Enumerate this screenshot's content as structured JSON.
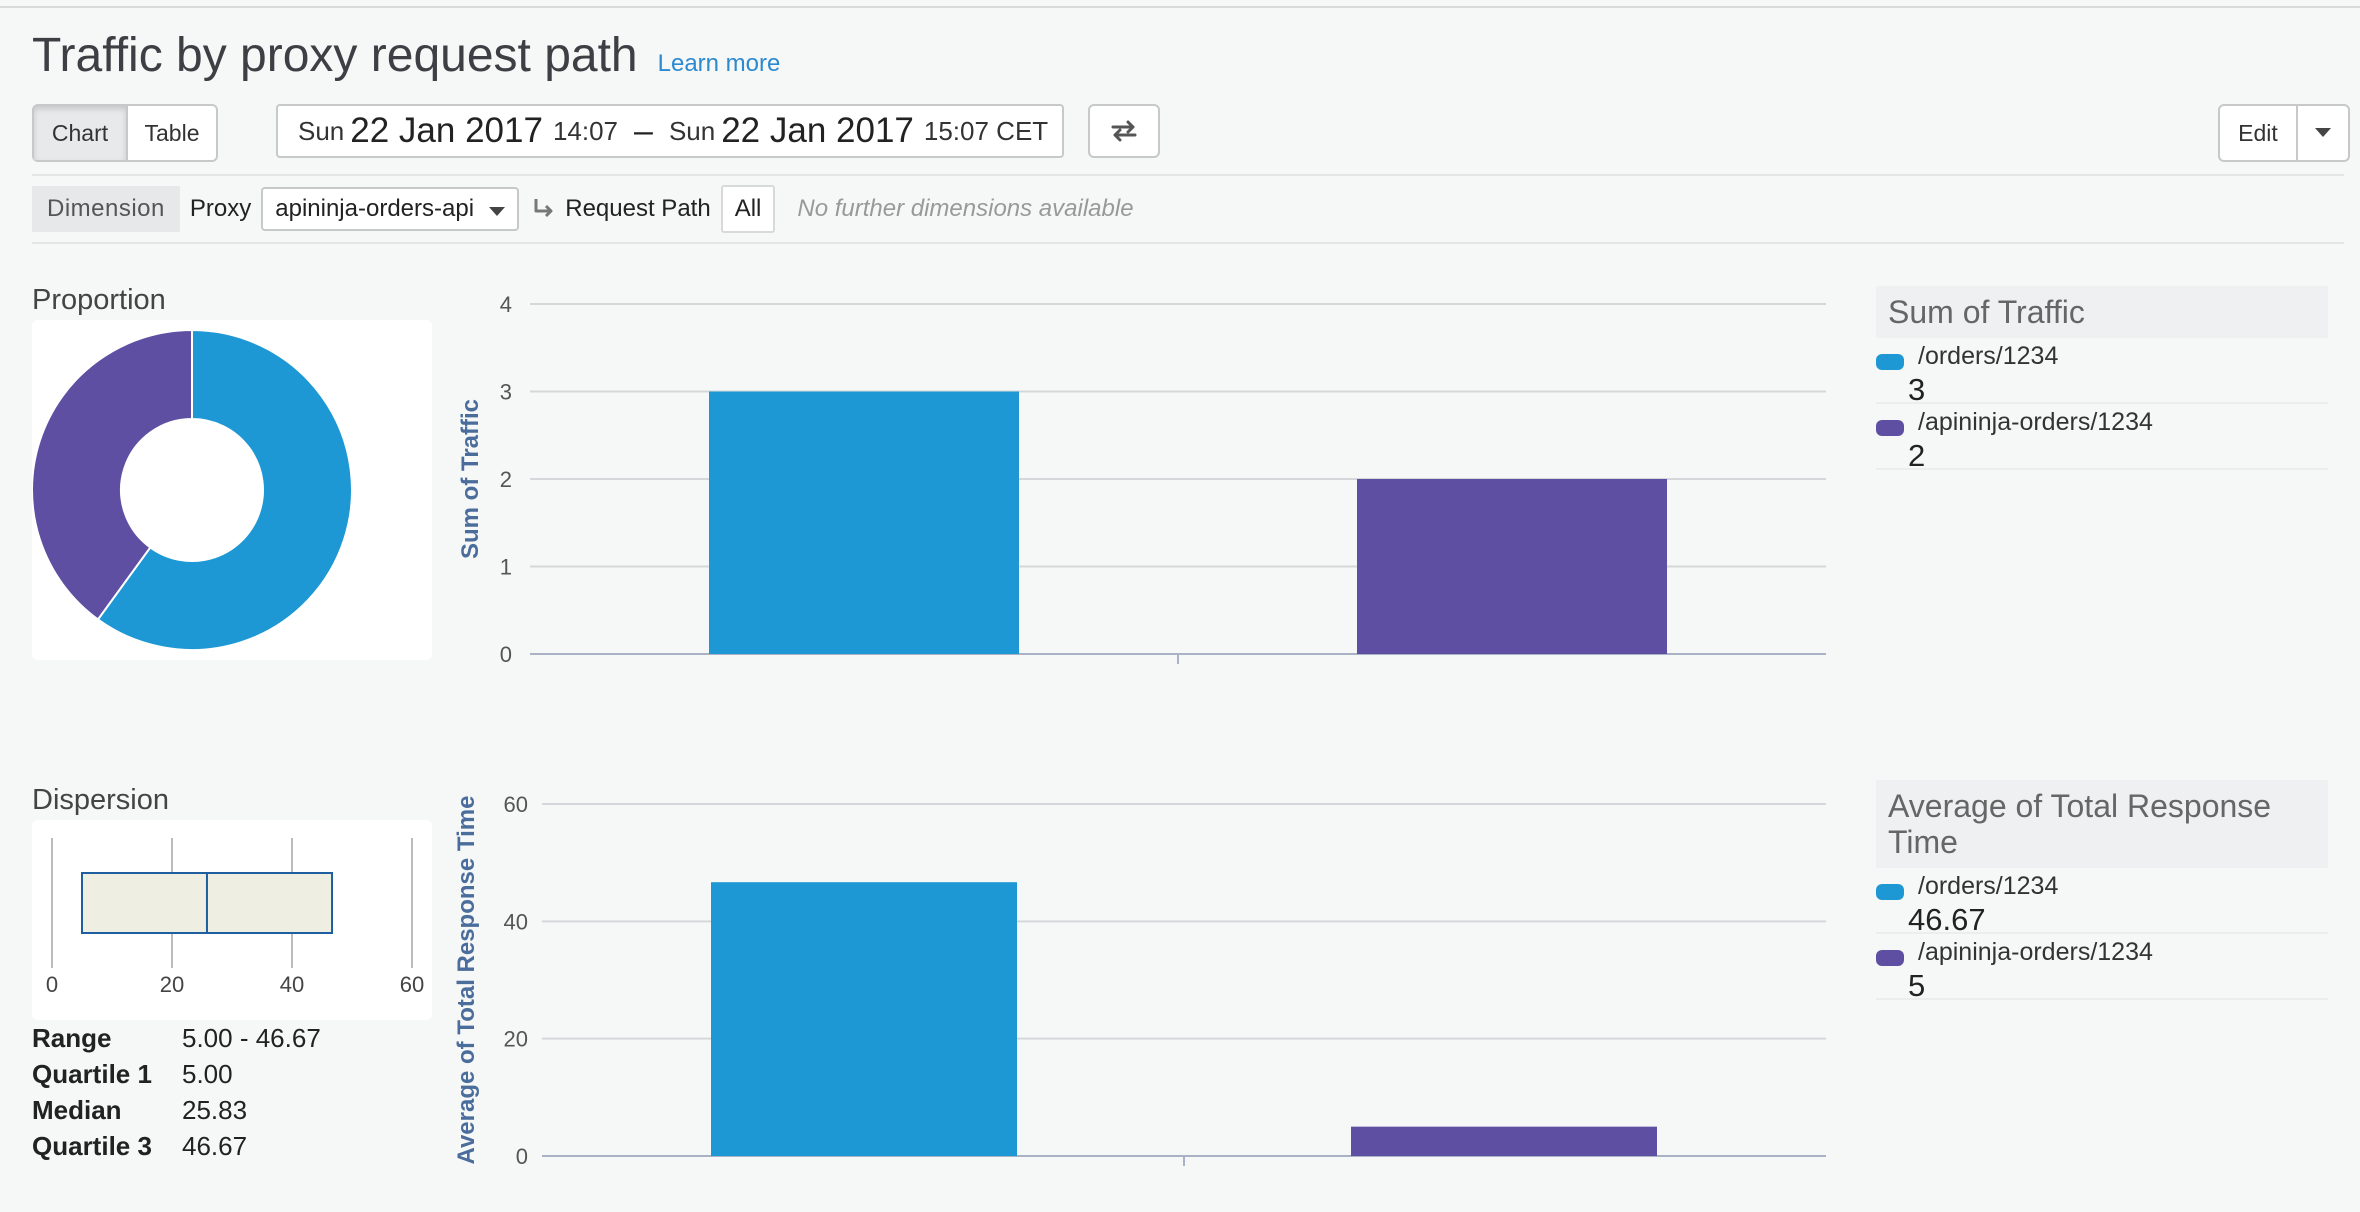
{
  "header": {
    "title": "Traffic by proxy request path",
    "learn_more": "Learn more"
  },
  "view_toggle": {
    "chart": "Chart",
    "table": "Table",
    "selected": "Chart"
  },
  "date_range": {
    "start_day": "Sun",
    "start_date": "22 Jan 2017",
    "start_time": "14:07",
    "separator": "–",
    "end_day": "Sun",
    "end_date": "22 Jan 2017",
    "end_time": "15:07 CET"
  },
  "toolbar": {
    "swap_icon": "swap-arrows-icon",
    "edit": "Edit"
  },
  "dimension_bar": {
    "dimension_label": "Dimension",
    "proxy_label": "Proxy",
    "proxy_value": "apininja-orders-api",
    "request_path_label": "Request Path",
    "request_path_value": "All",
    "no_further": "No further dimensions available"
  },
  "colors": {
    "blue": "#1e98d4",
    "purple": "#5e4fa2",
    "grid": "#d5d8da",
    "axis_title": "#4a6d9c"
  },
  "proportion": {
    "title": "Proportion"
  },
  "dispersion": {
    "title": "Dispersion",
    "stats": [
      {
        "key": "Range",
        "value": "5.00 - 46.67"
      },
      {
        "key": "Quartile 1",
        "value": "5.00"
      },
      {
        "key": "Median",
        "value": "25.83"
      },
      {
        "key": "Quartile 3",
        "value": "46.67"
      }
    ]
  },
  "legend_traffic": {
    "title": "Sum of Traffic",
    "items": [
      {
        "name": "/orders/1234",
        "value": "3"
      },
      {
        "name": "/apininja-orders/1234",
        "value": "2"
      }
    ]
  },
  "legend_response": {
    "title": "Average of Total Response Time",
    "items": [
      {
        "name": "/orders/1234",
        "value": "46.67"
      },
      {
        "name": "/apininja-orders/1234",
        "value": "5"
      }
    ]
  },
  "chart_data": [
    {
      "type": "pie",
      "title": "Proportion",
      "labels": [
        "/orders/1234",
        "/apininja-orders/1234"
      ],
      "values": [
        3,
        2
      ]
    },
    {
      "type": "bar",
      "categories": [
        "/orders/1234",
        "/apininja-orders/1234"
      ],
      "values": [
        3,
        2
      ],
      "xlabel": "",
      "ylabel": "Sum of Traffic",
      "ylim": [
        0,
        4
      ],
      "yticks": [
        0,
        1,
        2,
        3,
        4
      ],
      "grid": true
    },
    {
      "type": "box",
      "title": "Dispersion",
      "min": 5.0,
      "q1": 5.0,
      "median": 25.83,
      "q3": 46.67,
      "max": 46.67,
      "xlim": [
        0,
        60
      ],
      "xticks": [
        0,
        20,
        40,
        60
      ]
    },
    {
      "type": "bar",
      "categories": [
        "/orders/1234",
        "/apininja-orders/1234"
      ],
      "values": [
        46.67,
        5
      ],
      "xlabel": "",
      "ylabel": "Average of Total Response Time",
      "ylim": [
        0,
        60
      ],
      "yticks": [
        0,
        20,
        40,
        60
      ],
      "grid": true
    }
  ]
}
